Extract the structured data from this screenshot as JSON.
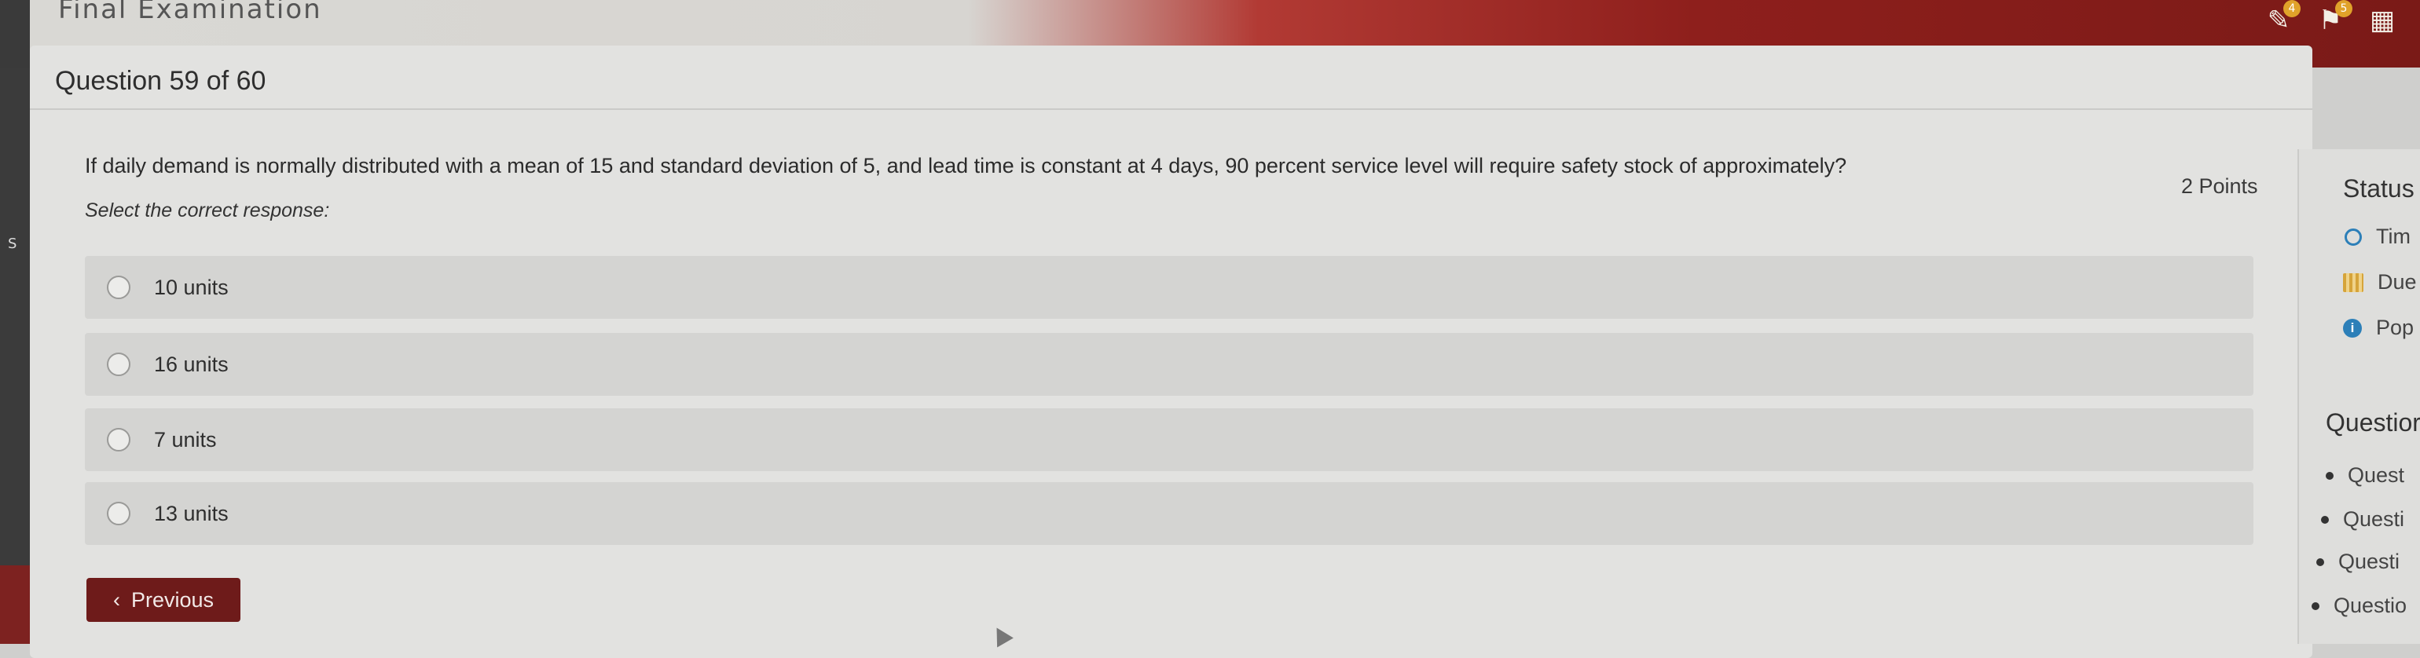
{
  "app": {
    "title": "Final Examination"
  },
  "header": {
    "icons": [
      {
        "name": "clipboard-icon",
        "badge": "4"
      },
      {
        "name": "bell-icon",
        "badge": "5"
      },
      {
        "name": "calendar-icon",
        "badge": ""
      }
    ]
  },
  "left_edge": {
    "label": "S"
  },
  "question": {
    "header": "Question 59 of 60",
    "text": "If daily demand is normally distributed with a mean of 15 and standard deviation of 5, and lead time is constant at 4 days, 90 percent service level will require safety stock of approximately?",
    "points": "2 Points",
    "instruction": "Select the correct response:",
    "options": [
      "10 units",
      "16 units",
      "7 units",
      "13 units"
    ]
  },
  "nav": {
    "previous_label": "Previous"
  },
  "side_panel": {
    "status_title": "Status",
    "status_items": [
      {
        "icon": "clock-icon",
        "label": "Tim"
      },
      {
        "icon": "calendar-icon",
        "label": "Due"
      },
      {
        "icon": "info-icon",
        "label": "Pop"
      }
    ],
    "questions_title": "Questior",
    "question_items": [
      "Quest",
      "Questi",
      "Questi",
      "Questio"
    ]
  },
  "colors": {
    "accent": "#7a1a17",
    "button": "#6e1b1a",
    "info": "#2c7fb8"
  }
}
